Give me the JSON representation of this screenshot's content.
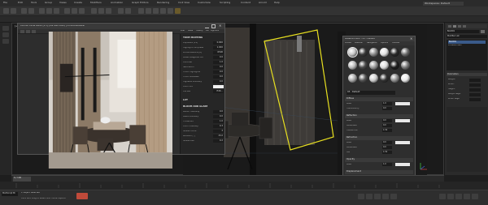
{
  "app": {
    "menus": [
      "File",
      "Edit",
      "Tools",
      "Group",
      "Views",
      "Create",
      "Modifiers",
      "Animation",
      "Graph Editors",
      "Rendering",
      "Civil View",
      "Customize",
      "Scripting",
      "Content",
      "Arnold",
      "Help"
    ],
    "workspace": "Workspaces: Default"
  },
  "viewport": {
    "label": "[+] [Perspective ] [Standard ] [Default Shading ]"
  },
  "frame_buffer": {
    "title": "Corona Frame Buffer [1.5] (3ds Max 2020) | Corona Renderer",
    "tabs": [
      "Post",
      "Stats",
      "History",
      "DR",
      "LightMix"
    ],
    "sections": [
      {
        "title": "TONE MAPPING",
        "rows": [
          {
            "label": "Exposure (EV)",
            "value": "0.000"
          },
          {
            "label": "Highlight compress",
            "value": "1.000"
          },
          {
            "label": "White balance [K]",
            "value": "6500"
          },
          {
            "label": "Green-Magenta tint",
            "value": "0.0"
          },
          {
            "label": "Contrast",
            "value": "1.0"
          },
          {
            "label": "Saturation",
            "value": "0.0"
          },
          {
            "label": "Filmic highlights",
            "value": "0.0"
          },
          {
            "label": "Filmic shadows",
            "value": "0.0"
          },
          {
            "label": "Vignette intensity",
            "value": "0.0"
          },
          {
            "label": "Color tint",
            "value": ""
          },
          {
            "label": "Curves",
            "value": "Edit..."
          }
        ]
      },
      {
        "title": "LUT",
        "rows": []
      },
      {
        "title": "BLOOM AND GLARE",
        "rows": [
          {
            "label": "Bloom intensity",
            "value": "0.0"
          },
          {
            "label": "Glare intensity",
            "value": "0.0"
          },
          {
            "label": "Threshold",
            "value": "1.0"
          },
          {
            "label": "Color intensity",
            "value": "0.3"
          },
          {
            "label": "Streak count",
            "value": "3"
          },
          {
            "label": "Rotation [°]",
            "value": "15.0"
          },
          {
            "label": "Streak blur",
            "value": "0.2"
          }
        ]
      }
    ]
  },
  "material_editor": {
    "title": "Material Editor - 03 - Default",
    "menu": [
      "Modes",
      "Material",
      "Navigation",
      "Options",
      "Utilities"
    ],
    "material_name": "03 - Default",
    "sections": [
      {
        "title": "Diffuse",
        "rows": [
          {
            "label": "Level",
            "value": "1.0"
          },
          {
            "label": "Translucency",
            "value": "0.0"
          }
        ]
      },
      {
        "title": "Reflection",
        "rows": [
          {
            "label": "Level",
            "value": "0.0"
          },
          {
            "label": "Glossiness",
            "value": "0.0"
          },
          {
            "label": "Fresnel IOR",
            "value": "1.52"
          }
        ]
      },
      {
        "title": "Refraction",
        "rows": [
          {
            "label": "Level",
            "value": "0.0"
          },
          {
            "label": "Glossiness",
            "value": "0.0"
          },
          {
            "label": "IOR",
            "value": "1.52"
          }
        ]
      },
      {
        "title": "Opacity",
        "rows": [
          {
            "label": "Level",
            "value": "1.0"
          }
        ]
      },
      {
        "title": "Displacement",
        "rows": [
          {
            "label": "Min level",
            "value": "0.0"
          },
          {
            "label": "Max level",
            "value": "1.0"
          }
        ]
      }
    ],
    "footer": "Subsurface scattering"
  },
  "command_panel": {
    "object": "Box001",
    "modifier_list": "Modifier List",
    "stack": [
      "Box001",
      "Editable Mesh"
    ],
    "params_title": "Parameters",
    "params": [
      {
        "label": "Length:",
        "value": ""
      },
      {
        "label": "Width:",
        "value": ""
      },
      {
        "label": "Height:",
        "value": ""
      },
      {
        "label": "Length Segs:",
        "value": ""
      },
      {
        "label": "Width Segs:",
        "value": ""
      }
    ]
  },
  "timeline": {
    "frame": "0 / 100"
  },
  "status": {
    "maxscript": "MAXScript Mi",
    "selected": "1 Object Selected",
    "prompt": "Click and drag to select and move objects"
  }
}
